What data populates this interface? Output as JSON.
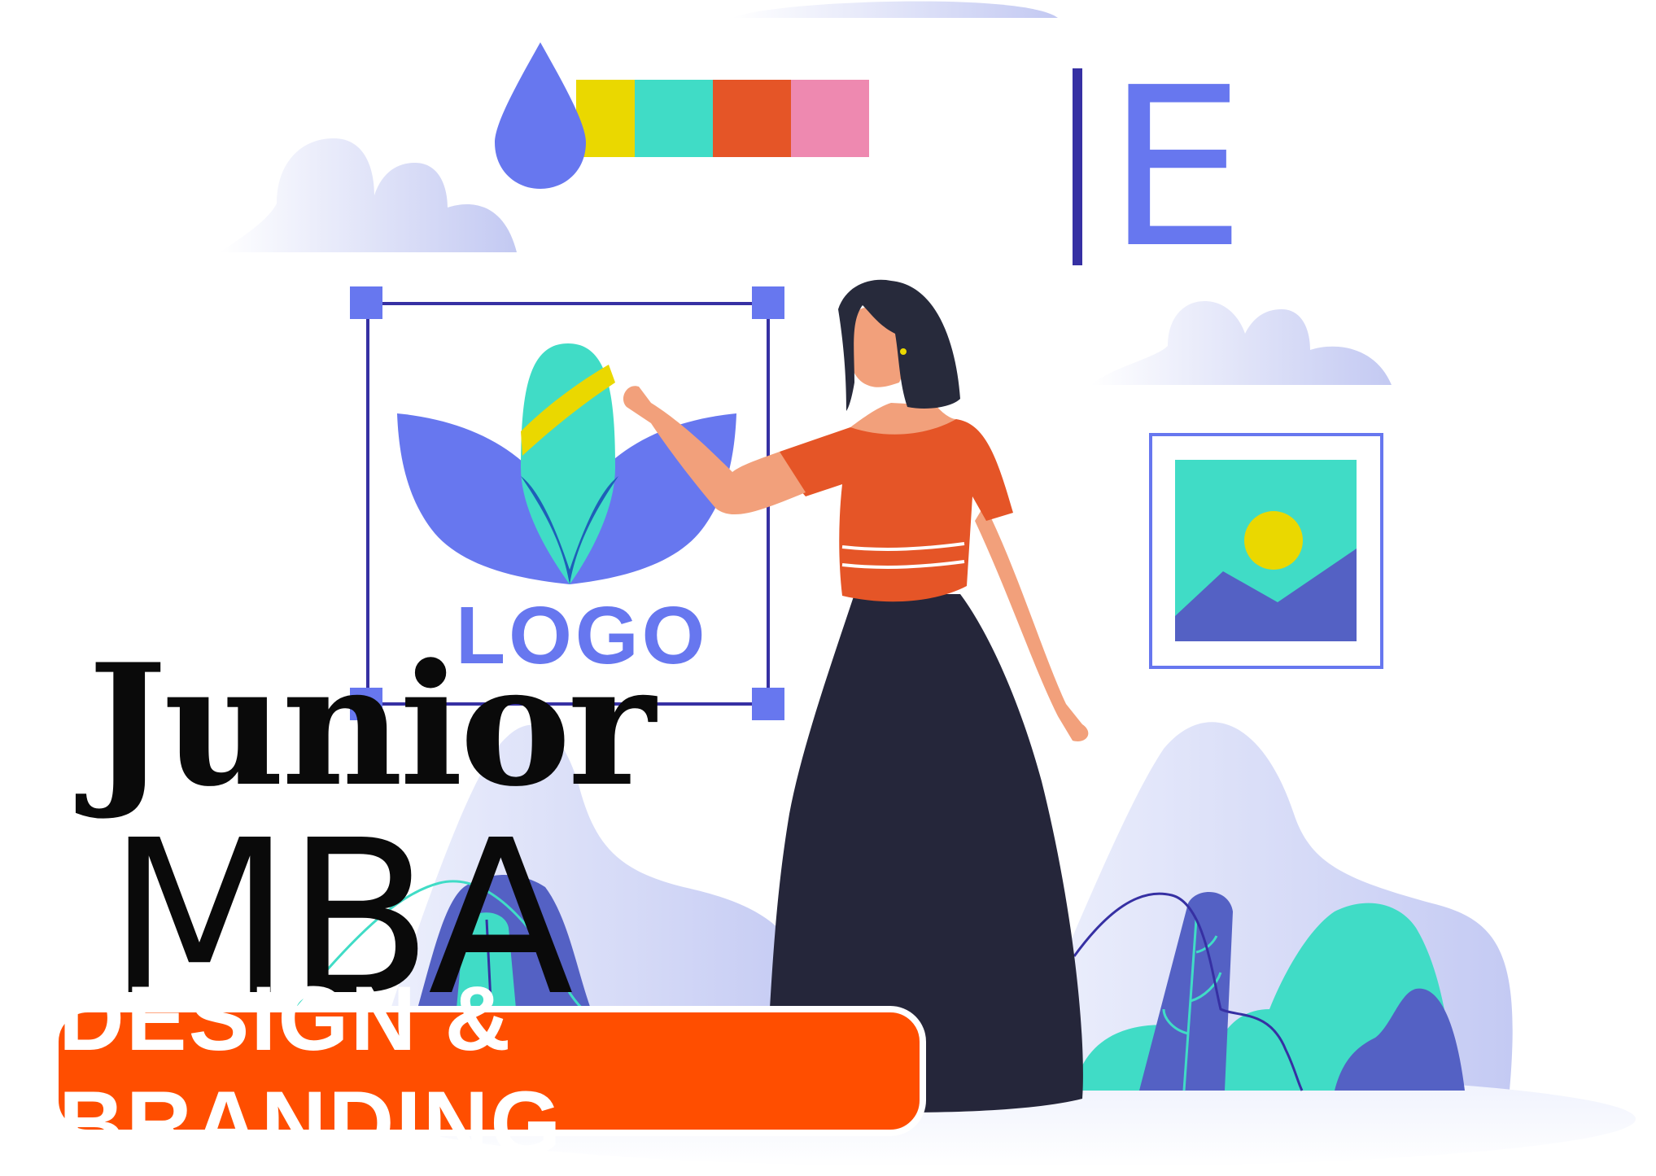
{
  "logo_mark": {
    "text": "LOGO"
  },
  "letter_tile": {
    "text": "E"
  },
  "headline": {
    "line1": "Junior",
    "line2": "MBA"
  },
  "badge": {
    "text": "DESIGN & BRANDING"
  },
  "colors": {
    "badge": "#FF4E00",
    "accent_blue": "#6777EF",
    "dark_blue": "#3630A3",
    "teal": "#40DCC6",
    "yellow": "#EAD800",
    "orange": "#E55527",
    "pink": "#EE89B0",
    "skirt": "#25263A",
    "skin": "#F2A07B",
    "hair": "#272A3B"
  },
  "palette_swatches": [
    "#EAD800",
    "#40DCC6",
    "#E55527",
    "#EE89B0"
  ]
}
